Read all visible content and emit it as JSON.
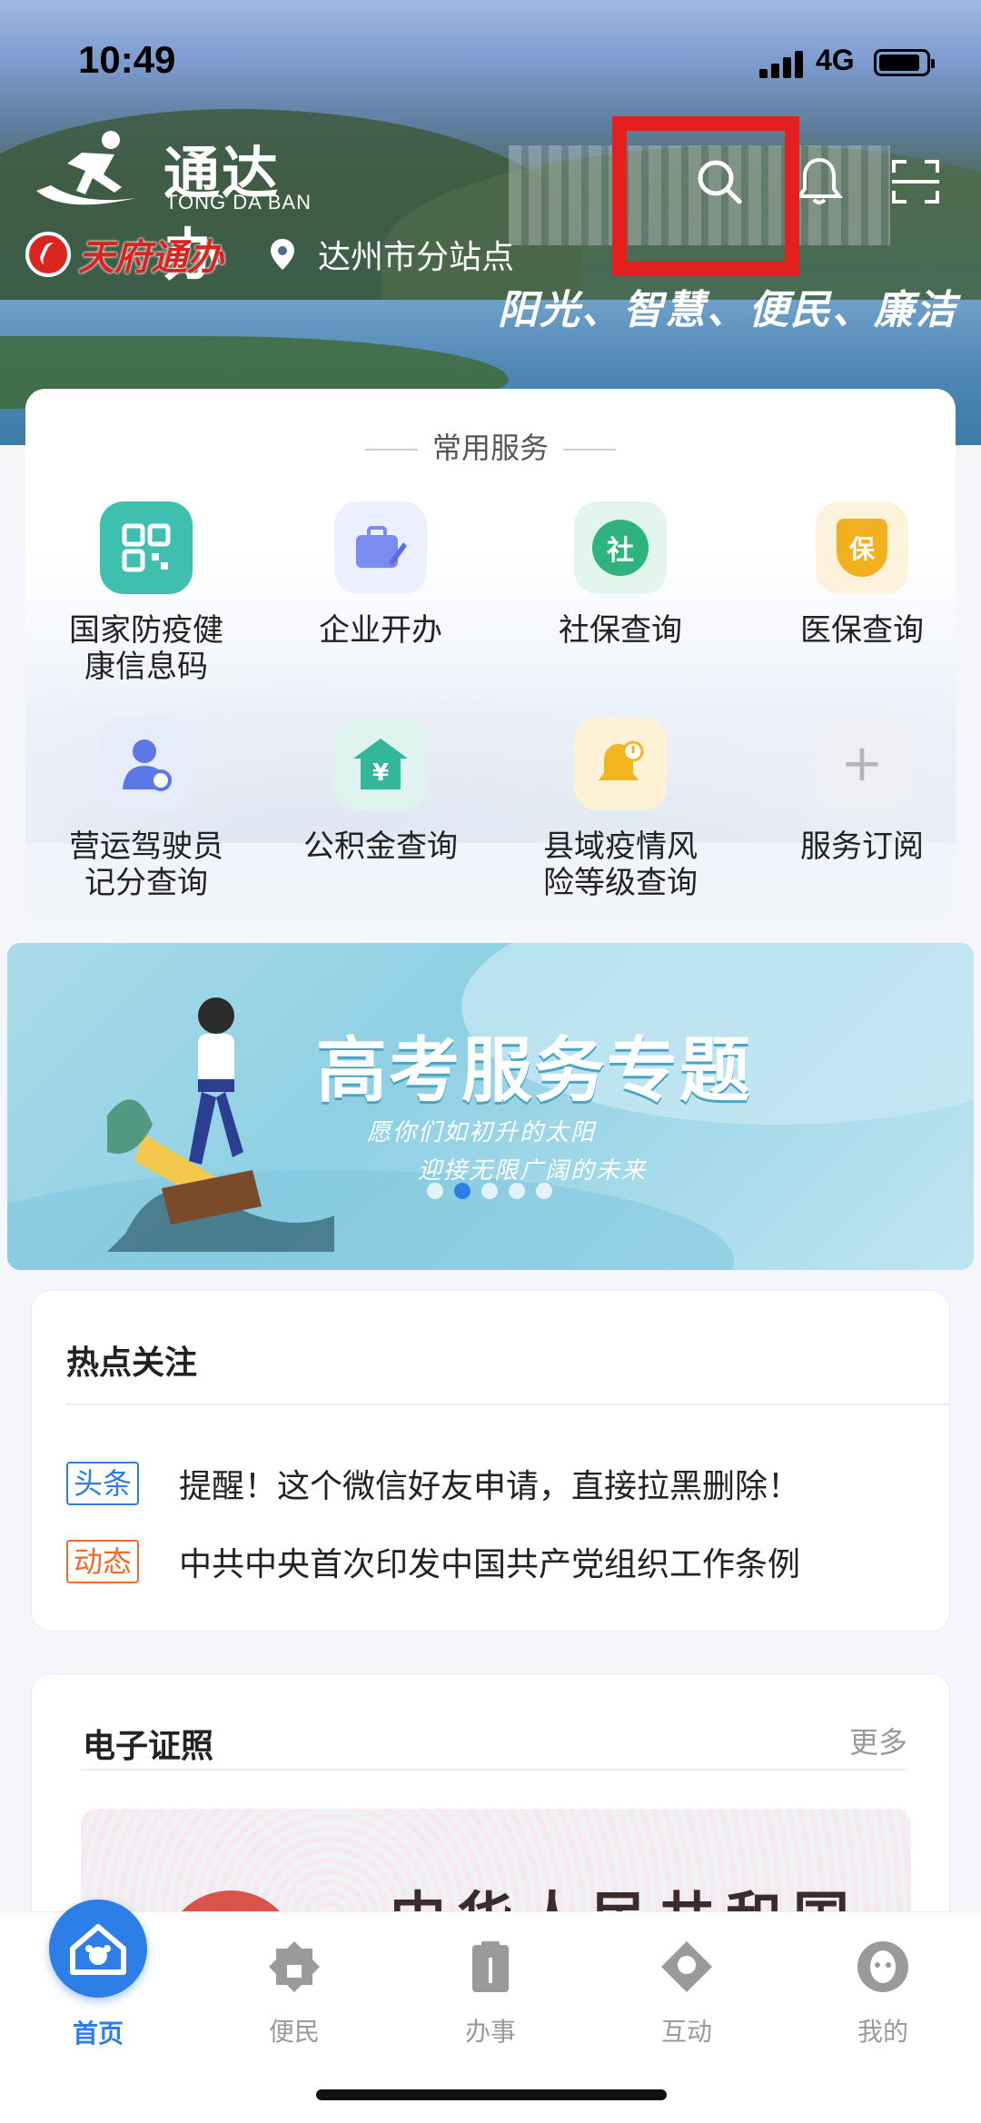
{
  "status": {
    "time": "10:49",
    "network": "4G"
  },
  "header": {
    "app_name": "通达办",
    "app_name_en": "TONG DA BAN",
    "partner_logo": "天府通办",
    "location": "达州市分站点",
    "slogan": "阳光、智慧、便民、廉洁",
    "icons": [
      "search-icon",
      "bell-icon",
      "scan-icon"
    ]
  },
  "services": {
    "title": "常用服务",
    "items": [
      {
        "label": "国家防疫健康信息码",
        "line1": "国家防疫健",
        "line2": "康信息码",
        "icon": "qr-code-icon",
        "color": "#3fbfb0"
      },
      {
        "label": "企业开办",
        "line1": "企业开办",
        "line2": "",
        "icon": "briefcase-icon",
        "color": "#7a8cf0"
      },
      {
        "label": "社保查询",
        "line1": "社保查询",
        "line2": "",
        "icon": "social-security-icon",
        "glyph": "社",
        "color": "#2fb37c"
      },
      {
        "label": "医保查询",
        "line1": "医保查询",
        "line2": "",
        "icon": "medical-insurance-icon",
        "glyph": "保",
        "color": "#f2b01e"
      },
      {
        "label": "营运驾驶员记分查询",
        "line1": "营运驾驶员",
        "line2": "记分查询",
        "icon": "driver-icon",
        "color": "#5b78e6"
      },
      {
        "label": "公积金查询",
        "line1": "公积金查询",
        "line2": "",
        "icon": "housing-fund-icon",
        "glyph": "¥",
        "color": "#34b69b"
      },
      {
        "label": "县域疫情风险等级查询",
        "line1": "县域疫情风",
        "line2": "险等级查询",
        "icon": "alert-bell-icon",
        "color": "#f3b51e"
      },
      {
        "label": "服务订阅",
        "line1": "服务订阅",
        "line2": "",
        "icon": "plus-icon",
        "glyph": "+",
        "color": "#b5b5b5"
      }
    ]
  },
  "banner": {
    "title": "高考服务专题",
    "sub1": "愿你们如初升的太阳",
    "sub2": "迎接无限广阔的未来",
    "dots": 5,
    "active_dot": 1
  },
  "hot": {
    "title": "热点关注",
    "items": [
      {
        "tag": "头条",
        "text": "提醒！这个微信好友申请，直接拉黑删除！"
      },
      {
        "tag": "动态",
        "text": "中共中央首次印发中国共产党组织工作条例"
      }
    ]
  },
  "certificates": {
    "title": "电子证照",
    "more": "更多",
    "card_text": "中华人民共和国"
  },
  "tabbar": {
    "tabs": [
      {
        "label": "首页",
        "icon": "home-icon",
        "active": true
      },
      {
        "label": "便民",
        "icon": "convenience-icon",
        "active": false
      },
      {
        "label": "办事",
        "icon": "affairs-icon",
        "active": false
      },
      {
        "label": "互动",
        "icon": "interact-icon",
        "active": false
      },
      {
        "label": "我的",
        "icon": "profile-icon",
        "active": false
      }
    ]
  },
  "colors": {
    "accent": "#2d7ee6",
    "highlight_box": "#e4201f",
    "tag_blue": "#2f7de1",
    "tag_orange": "#ef6b2a"
  }
}
